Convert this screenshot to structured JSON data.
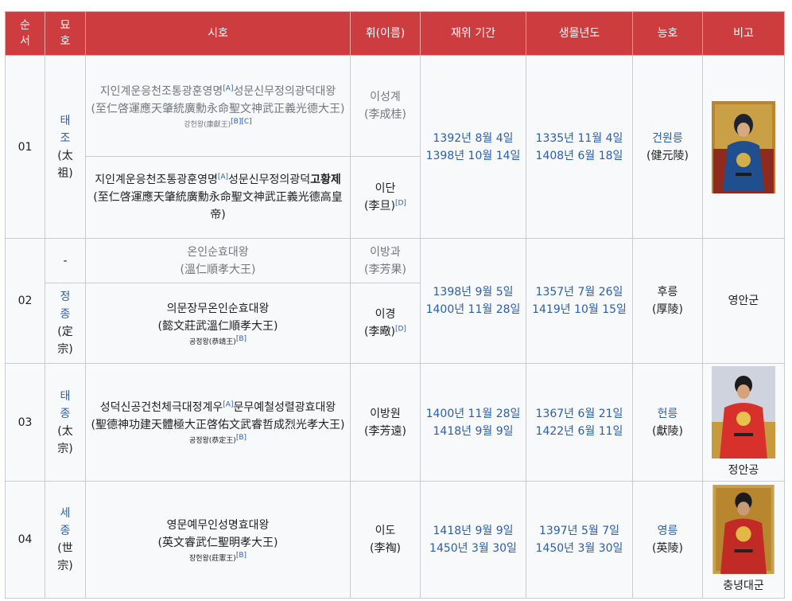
{
  "headers": {
    "order": "순\n서",
    "tomb": "묘\n호",
    "posthumous": "시호",
    "name": "휘(이름)",
    "reign": "재위 기간",
    "life": "생몰년도",
    "tomb_name": "능호",
    "notes": "비고"
  },
  "rows": [
    {
      "order": "01",
      "tomb_ko": "태\n조",
      "tomb_hanja": "(太\n祖)",
      "sub": [
        {
          "posthumous_ko_a": "지인계운응천조통광훈영명",
          "ref_a": "[A]",
          "posthumous_ko_b": "성문신무정의광덕대왕",
          "posthumous_hanja": "(至仁啓運應天肇統廣勳永命聖文神武正義光德大王)",
          "alt": "강헌왕(康獻王)",
          "alt_ref": "[B][C]",
          "name_ko": "이성계",
          "name_hanja": "(李成桂)"
        },
        {
          "posthumous_ko_a": "지인계운응천조통광훈영명",
          "ref_a": "[A]",
          "posthumous_ko_b": "성문신무정의광덕",
          "posthumous_ko_bold": "고황제",
          "posthumous_hanja": "(至仁啓運應天肇統廣勳永命聖文神武正義光德高皇帝)",
          "name_ko": "이단",
          "name_hanja": "(李旦)",
          "name_ref": "[D]"
        }
      ],
      "reign_start": "1392년 8월 4일",
      "reign_end": "1398년 10월 14일",
      "birth": "1335년 11월 4일",
      "death": "1408년 6월 18일",
      "tomb_name_ko": "건원릉",
      "tomb_name_hanja": "(健元陵)",
      "note": ""
    },
    {
      "order": "02",
      "sub": [
        {
          "tomb_ko": "-",
          "posthumous_ko": "온인순효대왕",
          "posthumous_hanja": "(溫仁順孝大王)",
          "name_ko": "이방과",
          "name_hanja": "(李芳果)"
        },
        {
          "tomb_ko": "정\n종",
          "tomb_hanja": "(定\n宗)",
          "posthumous_ko": "의문장무온인순효대왕",
          "posthumous_hanja": "(懿文莊武溫仁順孝大王)",
          "alt": "공정왕(恭靖王)",
          "alt_ref": "[B]",
          "name_ko": "이경",
          "name_hanja": "(李曔)",
          "name_ref": "[D]"
        }
      ],
      "reign_start": "1398년 9월 5일",
      "reign_end": "1400년 11월 28일",
      "birth": "1357년 7월 26일",
      "death": "1419년 10월 15일",
      "tomb_name_ko": "후릉",
      "tomb_name_hanja": "(厚陵)",
      "note": "영안군"
    },
    {
      "order": "03",
      "tomb_ko": "태\n종",
      "tomb_hanja": "(太\n宗)",
      "posthumous_ko_a": "성덕신공건천체극대정계우",
      "ref_a": "[A]",
      "posthumous_ko_b": "문무예철성렬광효대왕",
      "posthumous_hanja": "(聖德神功建天體極大正啓佑文武睿哲成烈光孝大王)",
      "alt": "공정왕(恭定王)",
      "alt_ref": "[B]",
      "name_ko": "이방원",
      "name_hanja": "(李芳遠)",
      "reign_start": "1400년 11월 28일",
      "reign_end": "1418년 9월 9일",
      "birth": "1367년 6월 21일",
      "death": "1422년 6월 11일",
      "tomb_name_ko": "헌릉",
      "tomb_name_hanja": "(獻陵)",
      "note": "정안공"
    },
    {
      "order": "04",
      "tomb_ko": "세\n종",
      "tomb_hanja": "(世\n宗)",
      "posthumous_ko": "영문예무인성명효대왕",
      "posthumous_hanja": "(英文睿武仁聖明孝大王)",
      "alt": "장헌왕(莊憲王)",
      "alt_ref": "[B]",
      "name_ko": "이도",
      "name_hanja": "(李祹)",
      "reign_start": "1418년 9월 9일",
      "reign_end": "1450년 3월 30일",
      "birth": "1397년 5월 7일",
      "death": "1450년 3월 30일",
      "tomb_name_ko": "영릉",
      "tomb_name_hanja": "(英陵)",
      "note": "충녕대군"
    }
  ],
  "colors": {
    "header_bg": "#cd3d3f",
    "link": "#2a5db0",
    "muted": "#72777d"
  }
}
